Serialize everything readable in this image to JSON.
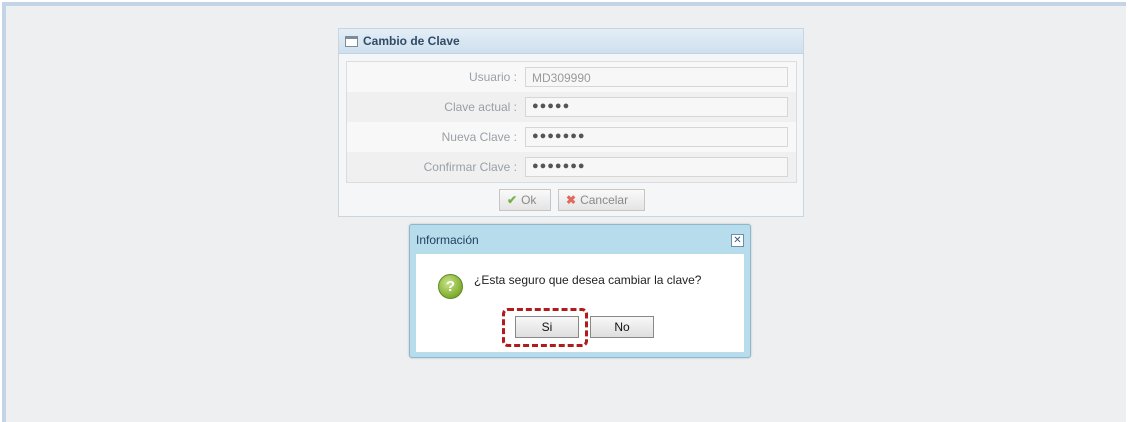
{
  "panel": {
    "title": "Cambio de Clave",
    "fields": [
      {
        "label": "Usuario :",
        "value": "MD309990"
      },
      {
        "label": "Clave actual :",
        "value": "●●●●●"
      },
      {
        "label": "Nueva Clave :",
        "value": "●●●●●●●"
      },
      {
        "label": "Confirmar Clave :",
        "value": "●●●●●●●"
      }
    ],
    "ok_label": "Ok",
    "cancel_label": "Cancelar"
  },
  "dialog": {
    "title": "Información",
    "message": "¿Esta seguro que desea cambiar la clave?",
    "icon": "question-icon",
    "yes_label": "Si",
    "no_label": "No",
    "close_symbol": "✕"
  },
  "colors": {
    "highlight": "#b01c1c",
    "dialog_frame": "#b7dceb"
  }
}
